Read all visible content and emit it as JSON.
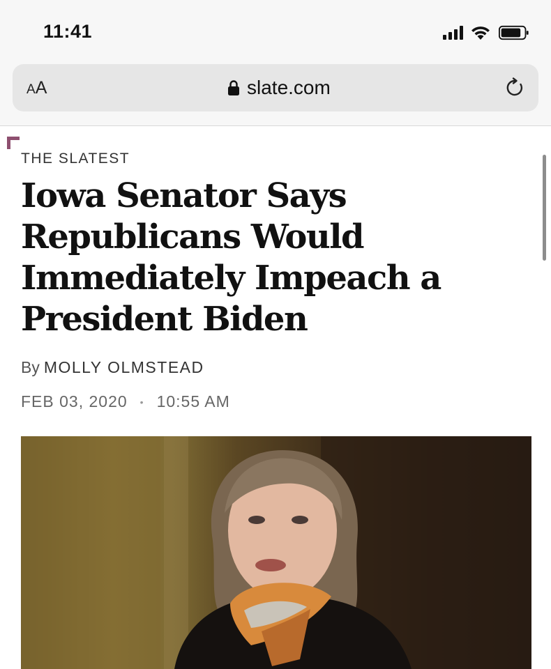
{
  "status_bar": {
    "time": "11:41"
  },
  "browser": {
    "aa_small": "A",
    "aa_large": "A",
    "url": "slate.com",
    "icons": [
      "lock-icon",
      "reload-icon"
    ]
  },
  "article": {
    "kicker": "THE SLATEST",
    "headline": "Iowa Senator Says Republicans Would Immediately Impeach a President Biden",
    "byline_prefix": "By",
    "author": "MOLLY OLMSTEAD",
    "date": "FEB 03, 2020",
    "time": "10:55 AM",
    "date_separator": "•"
  },
  "colors": {
    "accent": "#8e4f6f",
    "chrome_bg": "#f7f7f7",
    "address_bar_bg": "#e6e6e6"
  }
}
